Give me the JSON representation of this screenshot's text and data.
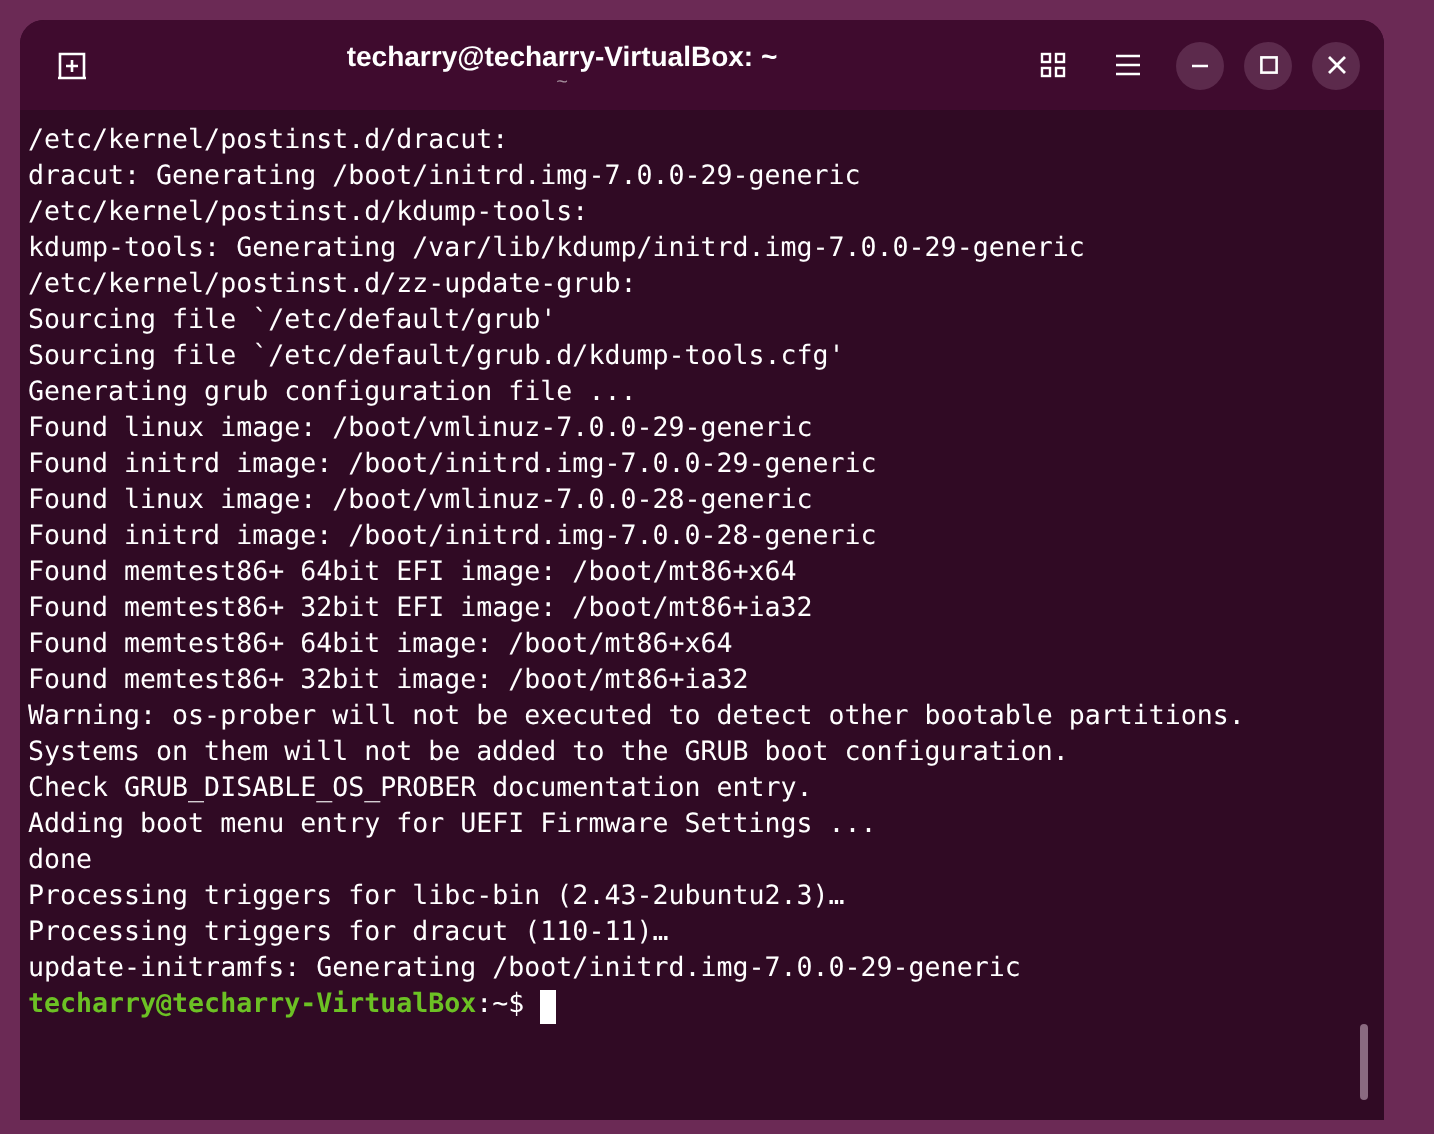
{
  "window": {
    "title": "techarry@techarry-VirtualBox: ~",
    "subtitle": "~"
  },
  "terminal": {
    "lines": [
      "/etc/kernel/postinst.d/dracut:",
      "dracut: Generating /boot/initrd.img-7.0.0-29-generic",
      "/etc/kernel/postinst.d/kdump-tools:",
      "kdump-tools: Generating /var/lib/kdump/initrd.img-7.0.0-29-generic",
      "/etc/kernel/postinst.d/zz-update-grub:",
      "Sourcing file `/etc/default/grub'",
      "Sourcing file `/etc/default/grub.d/kdump-tools.cfg'",
      "Generating grub configuration file ...",
      "Found linux image: /boot/vmlinuz-7.0.0-29-generic",
      "Found initrd image: /boot/initrd.img-7.0.0-29-generic",
      "Found linux image: /boot/vmlinuz-7.0.0-28-generic",
      "Found initrd image: /boot/initrd.img-7.0.0-28-generic",
      "Found memtest86+ 64bit EFI image: /boot/mt86+x64",
      "Found memtest86+ 32bit EFI image: /boot/mt86+ia32",
      "Found memtest86+ 64bit image: /boot/mt86+x64",
      "Found memtest86+ 32bit image: /boot/mt86+ia32",
      "Warning: os-prober will not be executed to detect other bootable partitions.",
      "Systems on them will not be added to the GRUB boot configuration.",
      "Check GRUB_DISABLE_OS_PROBER documentation entry.",
      "Adding boot menu entry for UEFI Firmware Settings ...",
      "done",
      "Processing triggers for libc-bin (2.43-2ubuntu2.3)…",
      "Processing triggers for dracut (110-11)…",
      "update-initramfs: Generating /boot/initrd.img-7.0.0-29-generic"
    ],
    "prompt": {
      "user_host": "techarry@techarry-VirtualBox",
      "path": ":~$"
    }
  }
}
